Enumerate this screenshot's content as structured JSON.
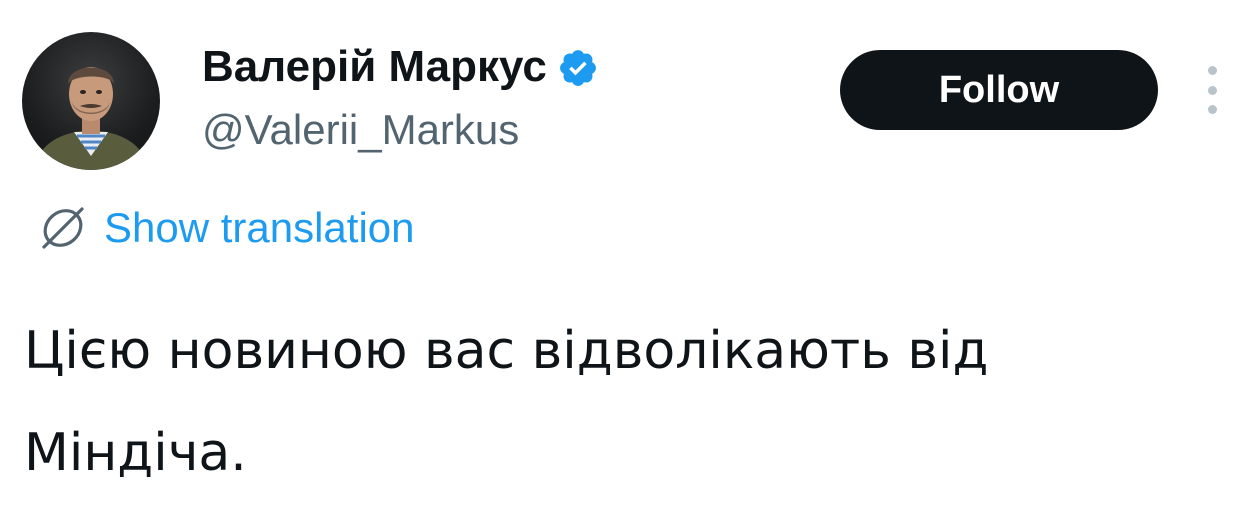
{
  "author": {
    "display_name": "Валерій Маркус",
    "handle": "@Valerii_Markus",
    "verified": true,
    "avatar_icon": "user-avatar-photo"
  },
  "actions": {
    "follow_label": "Follow",
    "more_icon": "more-vertical-icon"
  },
  "translation": {
    "label": "Show translation",
    "icon": "translate-globe-icon"
  },
  "tweet": {
    "text": "Цією новиною вас відволікають від Міндіча."
  },
  "colors": {
    "text_primary": "#0f1419",
    "text_secondary": "#536471",
    "accent_blue": "#1d9bf0",
    "button_bg": "#0f1419",
    "button_text": "#ffffff"
  }
}
